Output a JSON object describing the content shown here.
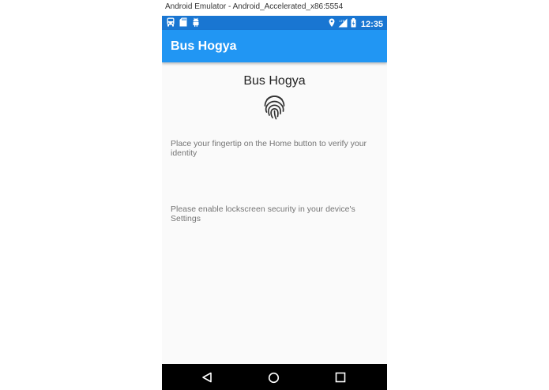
{
  "window": {
    "title": "Android Emulator - Android_Accelerated_x86:5554"
  },
  "status_bar": {
    "time": "12:35",
    "left_icons": [
      "bus-icon",
      "sd-card-icon",
      "android-icon"
    ],
    "right_icons": [
      "location-icon",
      "signal-icon",
      "battery-icon"
    ],
    "background": "#1976d2"
  },
  "app_bar": {
    "title": "Bus Hogya",
    "background": "#2196f3"
  },
  "content": {
    "title": "Bus Hogya",
    "icon": "fingerprint-icon",
    "message_fingerprint": "Place your fingertip on the Home button to verify your identity",
    "message_lockscreen": "Please enable lockscreen security in your device's Settings"
  },
  "nav_bar": {
    "buttons": [
      "back-icon",
      "home-icon",
      "recents-icon"
    ]
  }
}
